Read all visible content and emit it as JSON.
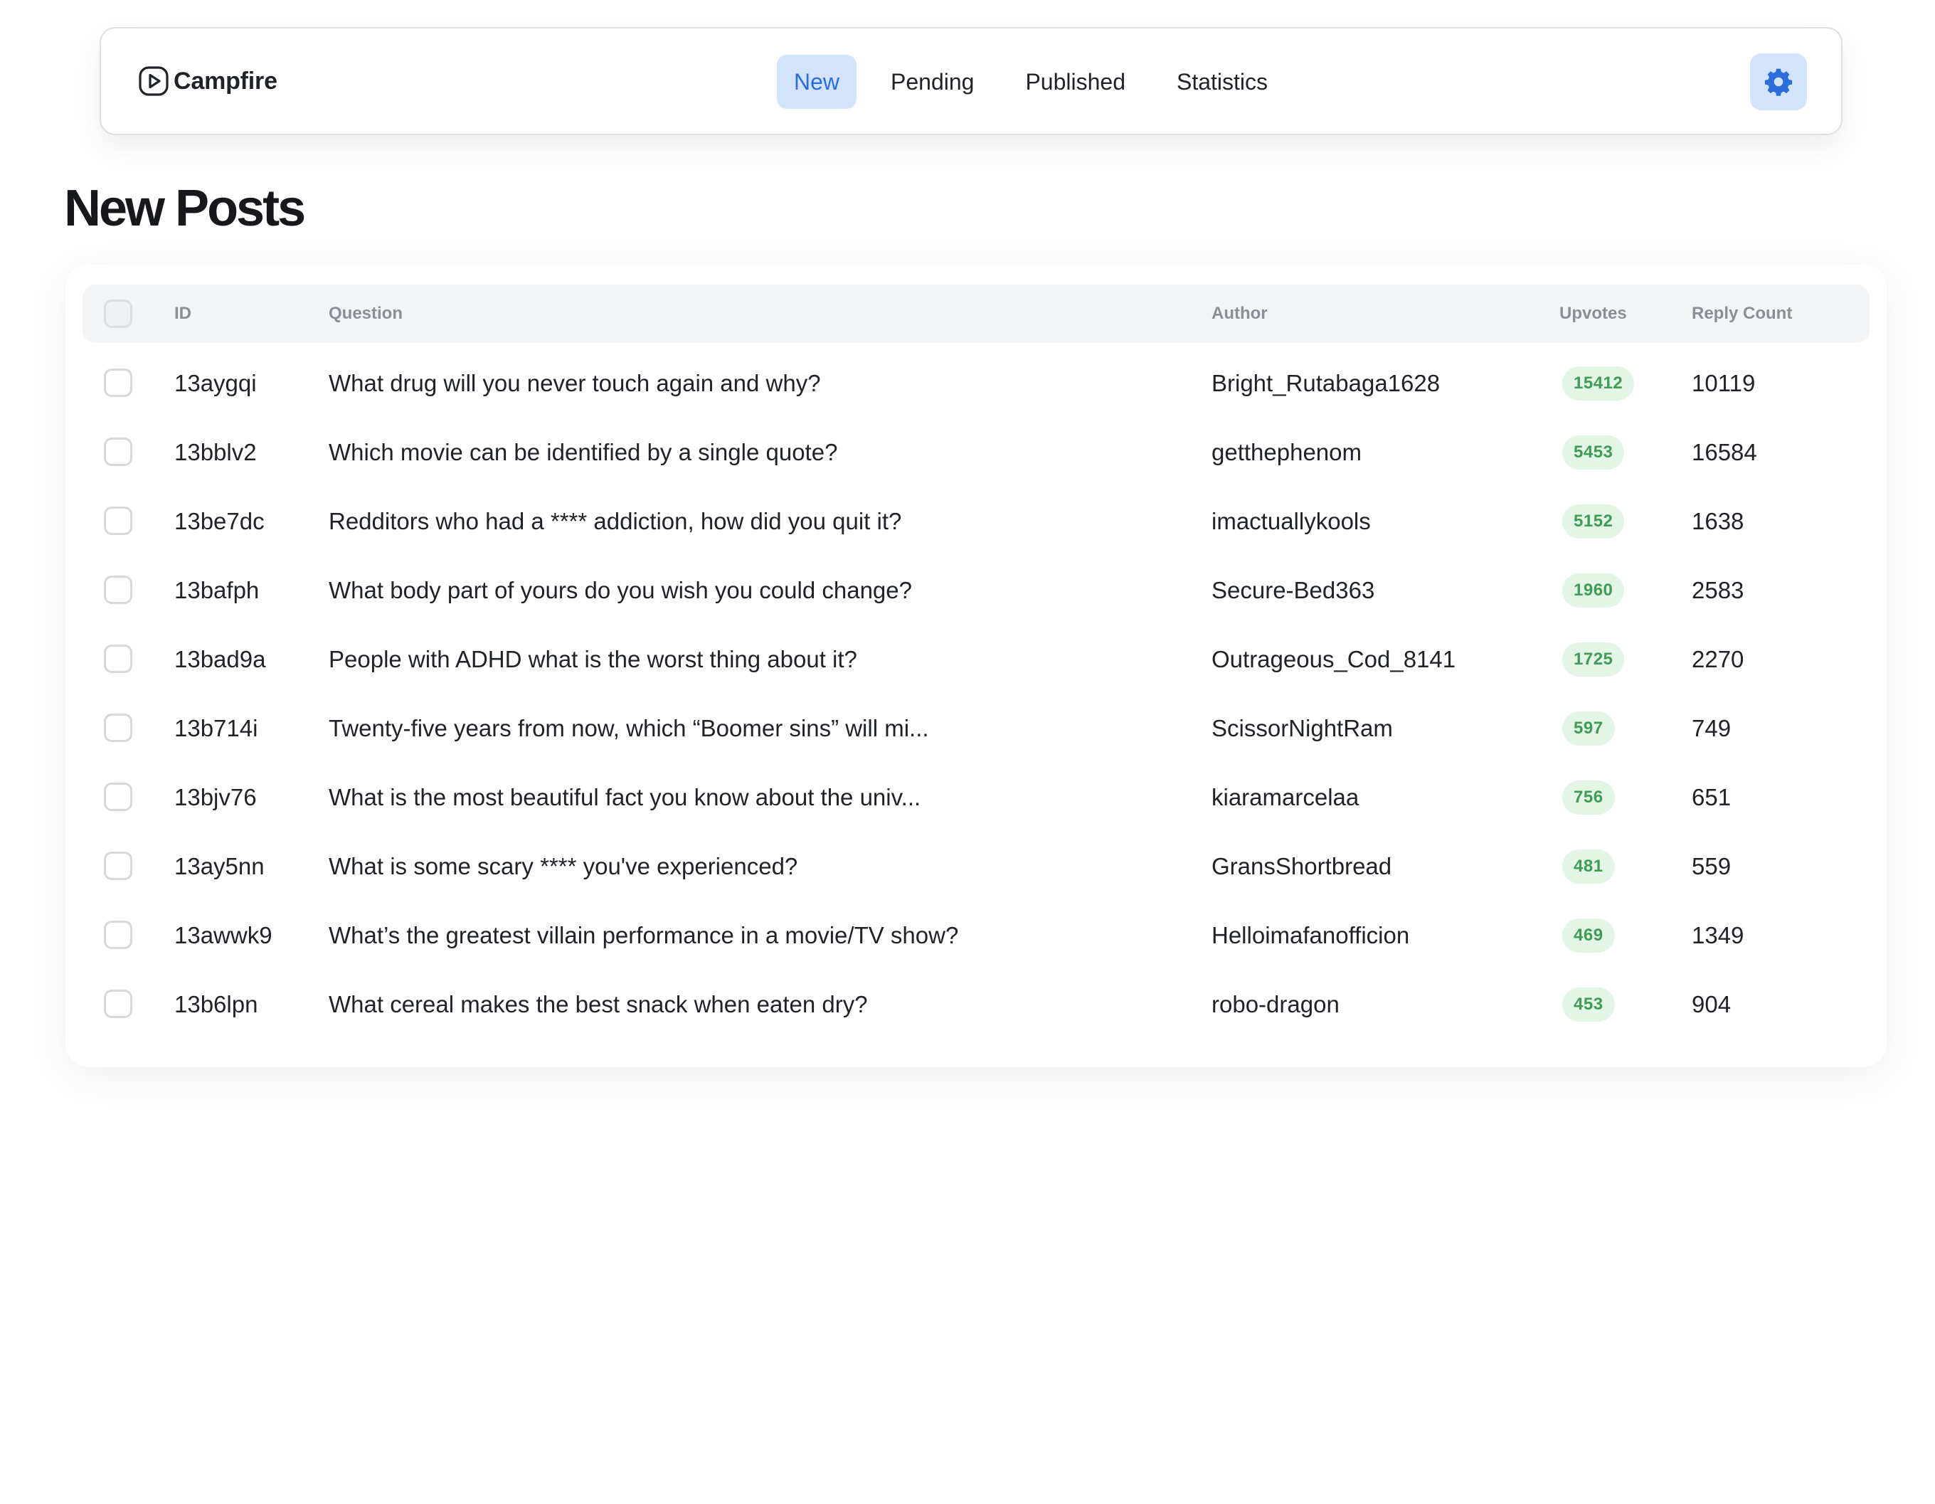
{
  "app": {
    "name": "Campfire",
    "logo_icon": "play-circle-icon"
  },
  "nav": {
    "tabs": [
      {
        "label": "New",
        "active": true
      },
      {
        "label": "Pending",
        "active": false
      },
      {
        "label": "Published",
        "active": false
      },
      {
        "label": "Statistics",
        "active": false
      }
    ],
    "settings_icon": "gear-icon"
  },
  "page": {
    "title": "New Posts"
  },
  "table": {
    "columns": [
      "ID",
      "Question",
      "Author",
      "Upvotes",
      "Reply Count"
    ],
    "rows": [
      {
        "id": "13aygqi",
        "question": "What drug will you never touch again and why?",
        "author": "Bright_Rutabaga1628",
        "upvotes": "15412",
        "replies": "10119"
      },
      {
        "id": "13bblv2",
        "question": "Which movie can be identified by a single quote?",
        "author": "getthephenom",
        "upvotes": "5453",
        "replies": "16584"
      },
      {
        "id": "13be7dc",
        "question": "Redditors who had a **** addiction, how did you quit it?",
        "author": "imactuallykools",
        "upvotes": "5152",
        "replies": "1638"
      },
      {
        "id": "13bafph",
        "question": "What body part of yours do you wish you could change?",
        "author": "Secure-Bed363",
        "upvotes": "1960",
        "replies": "2583"
      },
      {
        "id": "13bad9a",
        "question": "People with ADHD what is the worst thing about it?",
        "author": "Outrageous_Cod_8141",
        "upvotes": "1725",
        "replies": "2270"
      },
      {
        "id": "13b714i",
        "question": "Twenty-five years from now, which “Boomer sins” will mi...",
        "author": "ScissorNightRam",
        "upvotes": "597",
        "replies": "749"
      },
      {
        "id": "13bjv76",
        "question": "What is the most beautiful fact you know about the univ...",
        "author": "kiaramarcelaa",
        "upvotes": "756",
        "replies": "651"
      },
      {
        "id": "13ay5nn",
        "question": "What is some scary **** you've experienced?",
        "author": "GransShortbread",
        "upvotes": "481",
        "replies": "559"
      },
      {
        "id": "13awwk9",
        "question": "What’s the greatest villain performance in a movie/TV show?",
        "author": "Helloimafanofficion",
        "upvotes": "469",
        "replies": "1349"
      },
      {
        "id": "13b6lpn",
        "question": "What cereal makes the best snack when eaten dry?",
        "author": "robo-dragon",
        "upvotes": "453",
        "replies": "904"
      }
    ]
  },
  "colors": {
    "accent": "#2a6ddb",
    "accent_bg": "#d3e3fb",
    "badge_bg": "#e3f6e6",
    "badge_text": "#3f9b56",
    "header_bg": "#f3f4f6"
  }
}
